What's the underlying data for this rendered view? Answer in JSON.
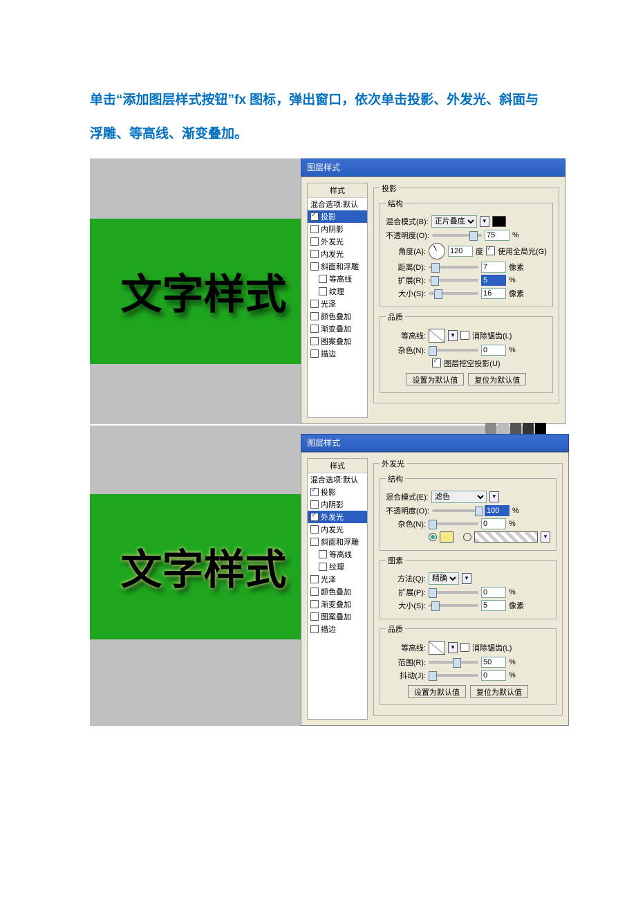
{
  "intro": "单击“添加图层样式按钮”fx 图标，弹出窗口，依次单击投影、外发光、斜面与浮雕、等高线、渐变叠加。",
  "sample_text": "文字样式",
  "dialog_title": "图层样式",
  "styles": {
    "head": "样式",
    "items": [
      {
        "label": "混合选项:默认",
        "check": false,
        "noBox": true
      },
      {
        "label": "投影",
        "check": true
      },
      {
        "label": "内阴影",
        "check": false
      },
      {
        "label": "外发光",
        "check": false
      },
      {
        "label": "内发光",
        "check": false
      },
      {
        "label": "斜面和浮雕",
        "check": false
      },
      {
        "label": "等高线",
        "check": false,
        "indent": true
      },
      {
        "label": "纹理",
        "check": false,
        "indent": true
      },
      {
        "label": "光泽",
        "check": false
      },
      {
        "label": "颜色叠加",
        "check": false
      },
      {
        "label": "渐变叠加",
        "check": false
      },
      {
        "label": "图案叠加",
        "check": false
      },
      {
        "label": "描边",
        "check": false
      }
    ]
  },
  "styles2": {
    "head": "样式",
    "items": [
      {
        "label": "混合选项:默认",
        "check": false,
        "noBox": true
      },
      {
        "label": "投影",
        "check": true
      },
      {
        "label": "内阴影",
        "check": false
      },
      {
        "label": "外发光",
        "check": true
      },
      {
        "label": "内发光",
        "check": false
      },
      {
        "label": "斜面和浮雕",
        "check": false
      },
      {
        "label": "等高线",
        "check": false,
        "indent": true
      },
      {
        "label": "纹理",
        "check": false,
        "indent": true
      },
      {
        "label": "光泽",
        "check": false
      },
      {
        "label": "颜色叠加",
        "check": false
      },
      {
        "label": "渐变叠加",
        "check": false
      },
      {
        "label": "图案叠加",
        "check": false
      },
      {
        "label": "描边",
        "check": false
      }
    ]
  },
  "shadow": {
    "group": "投影",
    "struct": "结构",
    "blend_label": "混合模式(B):",
    "blend_value": "正片叠底",
    "opacity_label": "不透明度(O):",
    "opacity_value": "75",
    "pct": "%",
    "angle_label": "角度(A):",
    "angle_value": "120",
    "deg": "度",
    "global": "使用全局光(G)",
    "dist_label": "距离(D):",
    "dist_value": "7",
    "px": "像素",
    "spread_label": "扩展(R):",
    "spread_value": "5",
    "size_label": "大小(S):",
    "size_value": "16",
    "quality": "品质",
    "contour_label": "等高线:",
    "antialias": "消除锯齿(L)",
    "noise_label": "杂色(N):",
    "noise_value": "0",
    "knockout": "图层挖空投影(U)",
    "btn_default": "设置为默认值",
    "btn_reset": "复位为默认值"
  },
  "glow": {
    "group": "外发光",
    "struct": "结构",
    "blend_label": "混合模式(E):",
    "blend_value": "滤色",
    "opacity_label": "不透明度(O):",
    "opacity_value": "100",
    "pct": "%",
    "noise_label": "杂色(N):",
    "noise_value": "0",
    "elem": "图素",
    "method_label": "方法(Q):",
    "method_value": "精确",
    "spread_label": "扩展(P):",
    "spread_value": "0",
    "size_label": "大小(S):",
    "size_value": "5",
    "px": "像素",
    "quality": "品质",
    "contour_label": "等高线:",
    "antialias": "消除锯齿(L)",
    "range_label": "范围(R):",
    "range_value": "50",
    "jitter_label": "抖动(J):",
    "jitter_value": "0",
    "btn_default": "设置为默认值",
    "btn_reset": "复位为默认值"
  }
}
